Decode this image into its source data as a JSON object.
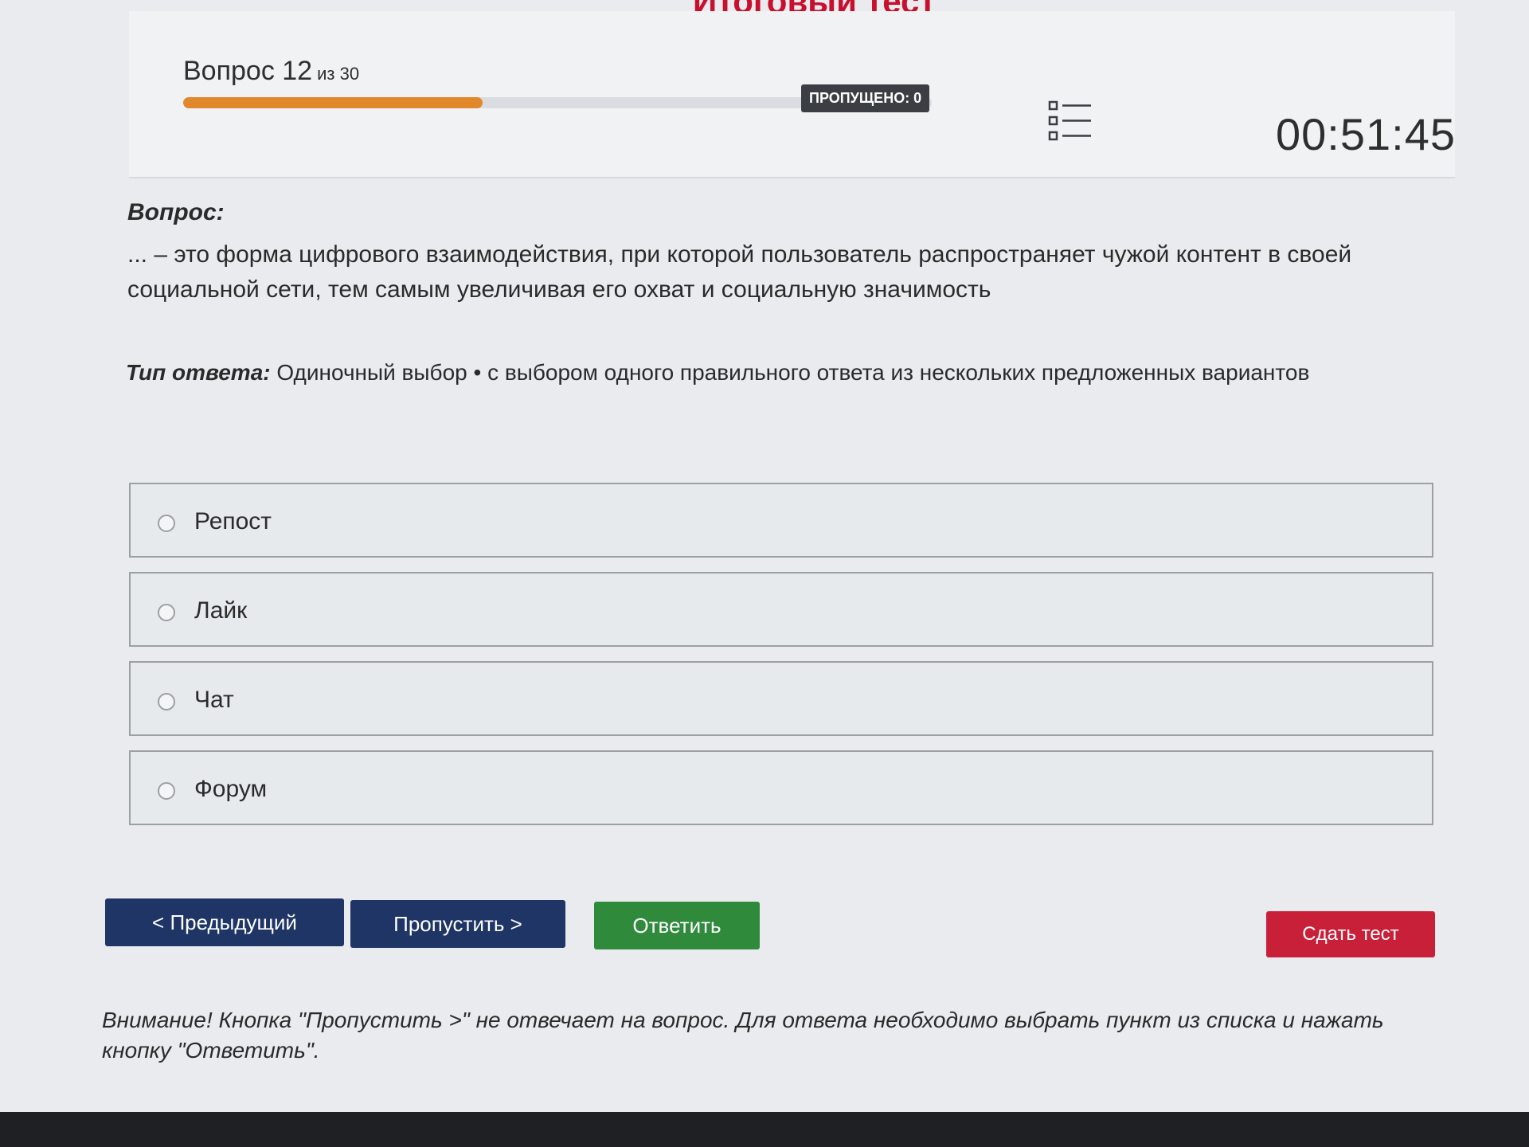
{
  "page_title": "Итоговый тест",
  "header": {
    "question_label": "Вопрос 12",
    "question_of": "из 30",
    "progress": 0.4,
    "skipped_badge": "ПРОПУЩЕНО: 0",
    "list_icon": "list-icon",
    "timer": "00:51:45"
  },
  "question": {
    "label": "Вопрос:",
    "text": "... – это форма цифрового взаимодействия, при которой пользователь распространяет чужой контент в своей социальной сети, тем самым увеличивая его охват и социальную значимость"
  },
  "answer_type": {
    "label": "Тип ответа:",
    "value": "Одиночный выбор • с выбором одного правильного ответа из нескольких предложенных вариантов"
  },
  "options": [
    {
      "label": "Репост",
      "selected": false
    },
    {
      "label": "Лайк",
      "selected": false
    },
    {
      "label": "Чат",
      "selected": false
    },
    {
      "label": "Форум",
      "selected": false
    }
  ],
  "buttons": {
    "prev": "< Предыдущий",
    "skip": "Пропустить >",
    "answer": "Ответить",
    "submit": "Сдать тест"
  },
  "colors": {
    "primary_button": "#1f3566",
    "answer_button": "#2f8a3c",
    "submit_button": "#c9203a",
    "progress": "#e0882a",
    "title": "#c8102e"
  },
  "notice": "Внимание! Кнопка \"Пропустить >\" не отвечает на вопрос. Для ответа необходимо выбрать пункт из списка и нажать кнопку \"Ответить\"."
}
